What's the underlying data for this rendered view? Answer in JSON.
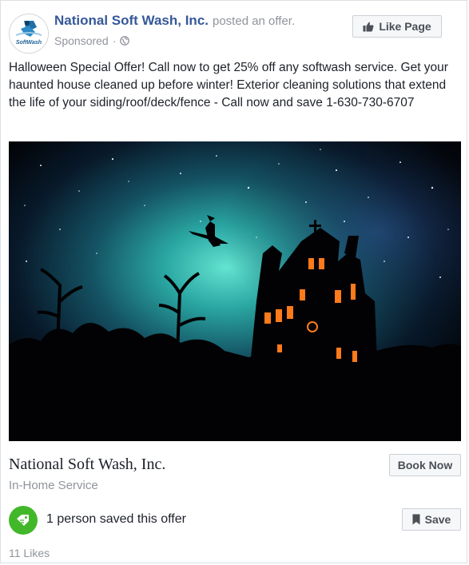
{
  "post": {
    "page_name": "National Soft Wash, Inc.",
    "action_text": "posted an offer.",
    "sponsored_label": "Sponsored",
    "meta_separator": "·",
    "like_page_label": "Like Page",
    "avatar_text": "SoftWash",
    "body_text": "Halloween Special Offer! Call now to get 25% off any softwash service. Get your haunted house cleaned up before winter! Exterior cleaning solutions that extend the life of your siding/roof/deck/fence - Call now and save 1-630-730-6707"
  },
  "offer": {
    "business_name": "National Soft Wash, Inc.",
    "category": "In-Home Service",
    "book_label": "Book Now",
    "saved_text": "1 person saved this offer",
    "save_label": "Save"
  },
  "footer": {
    "likes_text": "11 Likes"
  },
  "colors": {
    "link_blue": "#365899",
    "saved_green": "#42b72a",
    "sky_teal": "#2aa7a3",
    "window_orange": "#ff7a1a"
  },
  "icons": {
    "like": "thumbs-up-icon",
    "globe": "globe-icon",
    "offer": "offer-tag-icon",
    "bookmark": "bookmark-icon"
  }
}
